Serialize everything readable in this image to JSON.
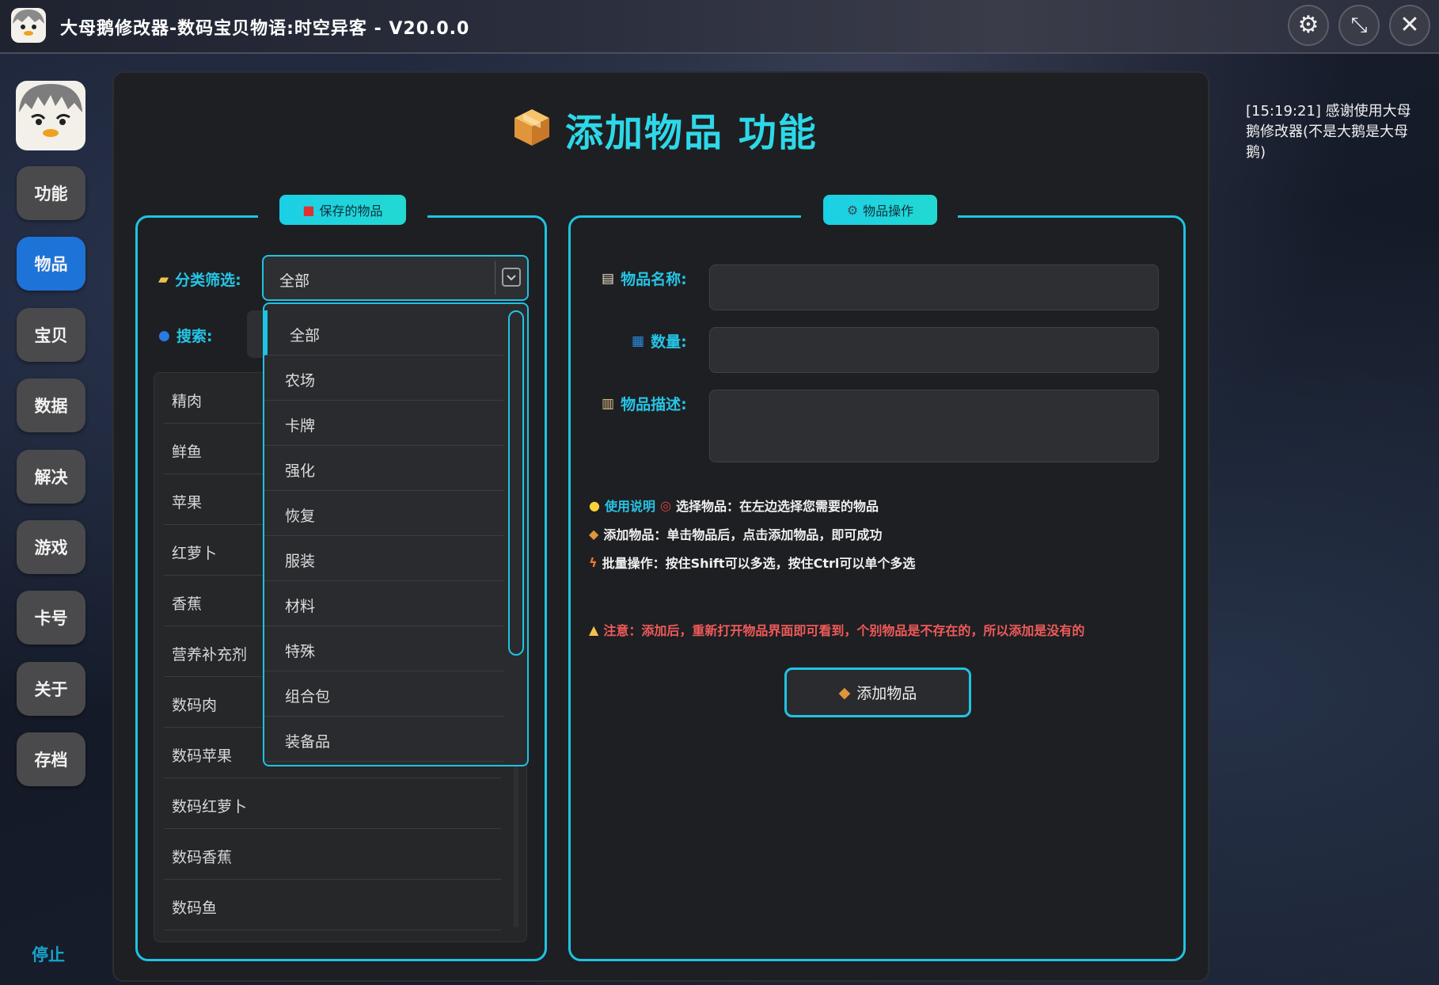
{
  "window": {
    "title": "大母鹅修改器-数码宝贝物语:时空异客 - V20.0.0",
    "buttons": [
      "settings",
      "minimize",
      "close"
    ]
  },
  "sidebar": {
    "items": [
      {
        "label": "功能",
        "active": false
      },
      {
        "label": "物品",
        "active": true
      },
      {
        "label": "宝贝",
        "active": false
      },
      {
        "label": "数据",
        "active": false
      },
      {
        "label": "解决",
        "active": false
      },
      {
        "label": "游戏",
        "active": false
      },
      {
        "label": "卡号",
        "active": false
      },
      {
        "label": "关于",
        "active": false
      },
      {
        "label": "存档",
        "active": false
      }
    ],
    "stop_label": "停止"
  },
  "main": {
    "title": "添加物品 功能",
    "left_group": {
      "tab_label": "保存的物品",
      "filter_label": "分类筛选:",
      "filter_value": "全部",
      "search_label": "搜索:",
      "items": [
        "精肉",
        "鲜鱼",
        "苹果",
        "红萝卜",
        "香蕉",
        "营养补充剂",
        "数码肉",
        "数码苹果",
        "数码红萝卜",
        "数码香蕉",
        "数码鱼"
      ],
      "dropdown_options": [
        "全部",
        "农场",
        "卡牌",
        "强化",
        "恢复",
        "服装",
        "材料",
        "特殊",
        "组合包",
        "装备品"
      ]
    },
    "right_group": {
      "tab_label": "物品操作",
      "name_label": "物品名称:",
      "qty_label": "数量:",
      "desc_label": "物品描述:",
      "name_value": "",
      "qty_value": "",
      "desc_value": ""
    },
    "tips": {
      "usage_title": "使用说明",
      "line1": "选择物品：在左边选择您需要的物品",
      "line2": "添加物品：单击物品后，点击添加物品，即可成功",
      "line3": "批量操作：按住Shift可以多选，按住Ctrl可以单个多选",
      "warning": "注意：添加后，重新打开物品界面即可看到，个别物品是不存在的，所以添加是没有的"
    },
    "add_button": "添加物品"
  },
  "log": {
    "text": "[15:19:21] 感谢使用大母鹅修改器(不是大鹅是大母鹅)"
  },
  "colors": {
    "accent": "#1fc3e3",
    "active_nav": "#1e73d8",
    "warning": "#f05a5a",
    "panel": "#1e1f22"
  }
}
